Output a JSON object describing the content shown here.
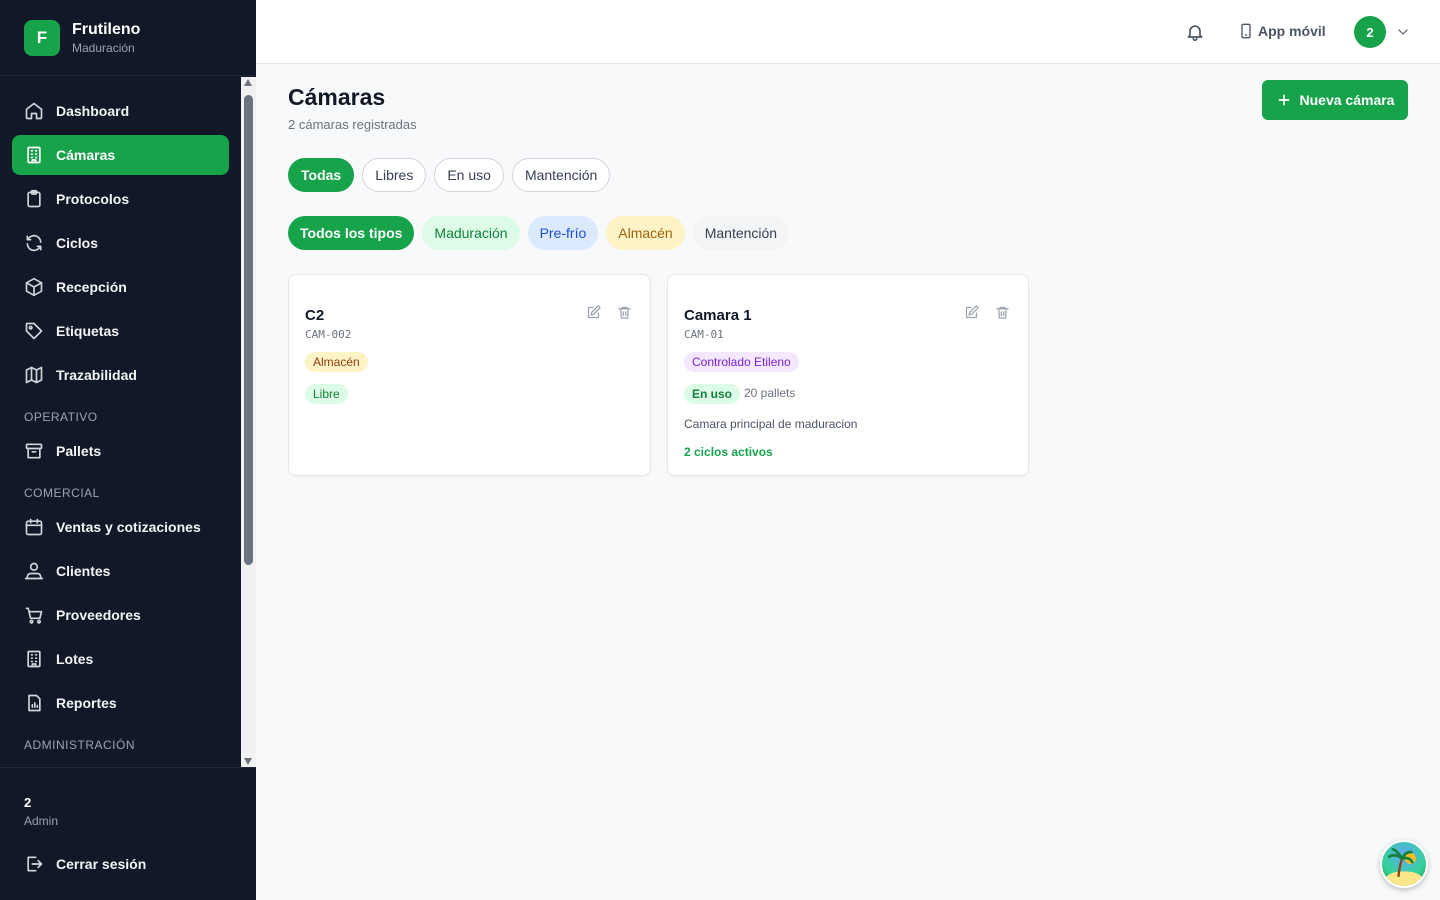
{
  "brand": {
    "initial": "F",
    "name": "Frutileno",
    "subtitle": "Maduración"
  },
  "sidebar": {
    "items": [
      {
        "label": "Dashboard",
        "icon": "home-icon",
        "active": false
      },
      {
        "label": "Cámaras",
        "icon": "building-icon",
        "active": true
      },
      {
        "label": "Protocolos",
        "icon": "clipboard-icon",
        "active": false
      },
      {
        "label": "Ciclos",
        "icon": "refresh-icon",
        "active": false
      },
      {
        "label": "Recepción",
        "icon": "package-icon",
        "active": false
      },
      {
        "label": "Etiquetas",
        "icon": "tag-icon",
        "active": false
      },
      {
        "label": "Trazabilidad",
        "icon": "map-icon",
        "active": false
      }
    ],
    "section_operativo": "OPERATIVO",
    "operativo_items": [
      {
        "label": "Pallets",
        "icon": "archive-icon"
      }
    ],
    "section_comercial": "COMERCIAL",
    "comercial_items": [
      {
        "label": "Ventas y cotizaciones",
        "icon": "calendar-icon"
      },
      {
        "label": "Clientes",
        "icon": "users-icon"
      },
      {
        "label": "Proveedores",
        "icon": "cart-icon"
      },
      {
        "label": "Lotes",
        "icon": "building-icon"
      },
      {
        "label": "Reportes",
        "icon": "report-icon"
      }
    ],
    "section_admin": "ADMINISTRACIÓN",
    "user": {
      "name": "2",
      "role": "Admin"
    },
    "logout_label": "Cerrar sesión"
  },
  "topbar": {
    "app_label": "App móvil",
    "avatar_initial": "2"
  },
  "page": {
    "title": "Cámaras",
    "subtitle": "2 cámaras registradas",
    "new_button": "Nueva cámara"
  },
  "status_filters": [
    "Todas",
    "Libres",
    "En uso",
    "Mantención"
  ],
  "type_filters": [
    "Todos los tipos",
    "Maduración",
    "Pre-frío",
    "Almacén",
    "Mantención"
  ],
  "cameras": [
    {
      "name": "C2",
      "code": "CAM-002",
      "type": "Almacén",
      "status": "Libre"
    },
    {
      "name": "Camara 1",
      "code": "CAM-01",
      "type": "Controlado Etileno",
      "status": "En uso",
      "pallets": "20 pallets",
      "description": "Camara principal de maduracion",
      "cycles": "2 ciclos activos"
    }
  ],
  "colors": {
    "accent": "#16a34a",
    "sidebar_bg": "#111827"
  }
}
